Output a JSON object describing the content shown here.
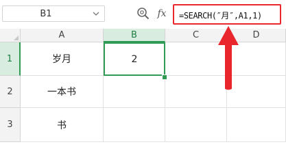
{
  "formula_bar": {
    "name_box_value": "B1",
    "fx_label": "fx",
    "formula": "=SEARCH(″月″,A1,1)"
  },
  "sheet": {
    "columns": [
      "A",
      "B",
      "C",
      "D"
    ],
    "rows": [
      {
        "label": "1",
        "cells": [
          "岁月",
          "2",
          "",
          ""
        ]
      },
      {
        "label": "2",
        "cells": [
          "一本书",
          "",
          "",
          ""
        ]
      },
      {
        "label": "3",
        "cells": [
          "书",
          "",
          "",
          ""
        ]
      }
    ],
    "selected_cell": "B1"
  },
  "colors": {
    "selection": "#2e9a54",
    "highlight": "#e8262b",
    "header_bg": "#f3f3f3",
    "active_header_bg": "#d8ecdf"
  },
  "icons": {
    "name_box_dropdown": "chevron-down-icon",
    "zoom": "zoom-icon",
    "annotation": "red-arrow-up"
  }
}
